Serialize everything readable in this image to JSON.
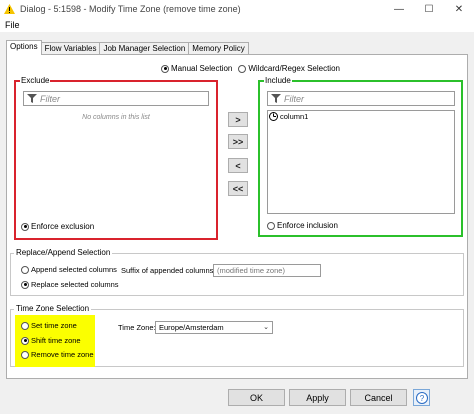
{
  "window": {
    "title": "Dialog - 5:1598 - Modify Time Zone (remove time zone)",
    "minimize": "—",
    "maximize": "☐",
    "close": "✕"
  },
  "menu": {
    "file": "File"
  },
  "tabs": [
    {
      "label": "Options"
    },
    {
      "label": "Flow Variables"
    },
    {
      "label": "Job Manager Selection"
    },
    {
      "label": "Memory Policy"
    }
  ],
  "mode": {
    "manual": "Manual Selection",
    "wildcard": "Wildcard/Regex Selection"
  },
  "exclude": {
    "title": "Exclude",
    "filter_placeholder": "Filter",
    "empty": "No columns in this list",
    "enforce": "Enforce exclusion",
    "border_color": "#d9232d"
  },
  "include": {
    "title": "Include",
    "filter_placeholder": "Filter",
    "columns": [
      "column1"
    ],
    "enforce": "Enforce inclusion",
    "border_color": "#2bc02b"
  },
  "move_buttons": {
    "add": ">",
    "add_all": ">>",
    "remove": "<",
    "remove_all": "<<"
  },
  "replace": {
    "title": "Replace/Append Selection",
    "append": "Append selected columns",
    "replace": "Replace selected columns",
    "suffix_label": "Suffix of appended columns:",
    "suffix_value": "(modified time zone)"
  },
  "timezone": {
    "title": "Time Zone Selection",
    "set": "Set time zone",
    "shift": "Shift time zone",
    "remove": "Remove time zone",
    "zone_label": "Time Zone:",
    "zone_value": "Europe/Amsterdam",
    "highlight_color": "#fbff00"
  },
  "footer": {
    "ok": "OK",
    "apply": "Apply",
    "cancel": "Cancel",
    "help": "?"
  }
}
